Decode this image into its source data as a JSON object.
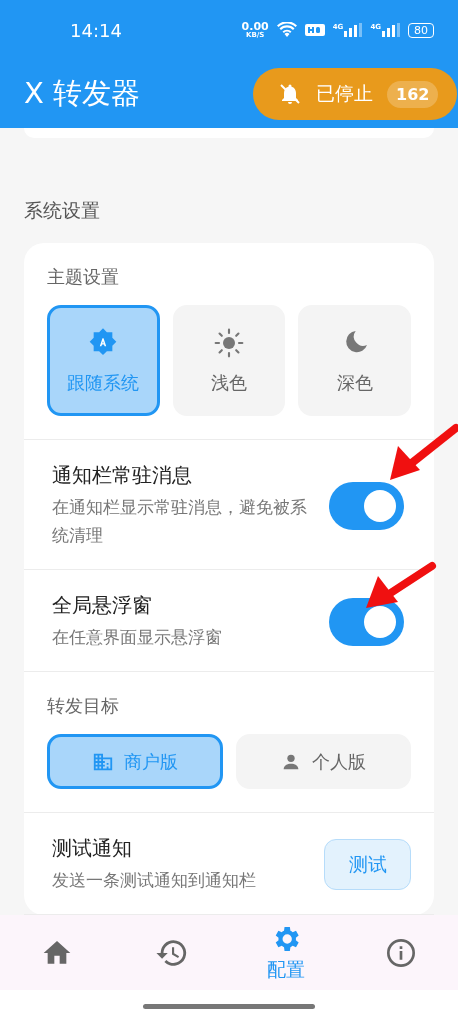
{
  "status_bar": {
    "time": "14:14",
    "net_speed": "0.00",
    "net_unit": "KB/S",
    "signal_labels": [
      "4G",
      "4G"
    ],
    "battery": "80"
  },
  "app_bar": {
    "title": "X 转发器",
    "status": {
      "label": "已停止",
      "count": "162",
      "running": false
    }
  },
  "section_title": "系统设置",
  "theme": {
    "label": "主题设置",
    "options": [
      {
        "kind": "auto",
        "label": "跟随系统",
        "selected": true
      },
      {
        "kind": "light",
        "label": "浅色",
        "selected": false
      },
      {
        "kind": "dark",
        "label": "深色",
        "selected": false
      }
    ]
  },
  "toggles": [
    {
      "title": "通知栏常驻消息",
      "subtitle": "在通知栏显示常驻消息，避免被系统清理",
      "on": true
    },
    {
      "title": "全局悬浮窗",
      "subtitle": "在任意界面显示悬浮窗",
      "on": true
    }
  ],
  "target": {
    "label": "转发目标",
    "options": [
      {
        "kind": "business",
        "label": "商户版",
        "selected": true
      },
      {
        "kind": "person",
        "label": "个人版",
        "selected": false
      }
    ]
  },
  "test": {
    "title": "测试通知",
    "subtitle": "发送一条测试通知到通知栏",
    "button": "测试"
  },
  "nav": [
    {
      "kind": "home",
      "selected": false
    },
    {
      "kind": "history",
      "selected": false
    },
    {
      "kind": "settings",
      "label": "配置",
      "selected": true
    },
    {
      "kind": "info",
      "selected": false
    }
  ]
}
